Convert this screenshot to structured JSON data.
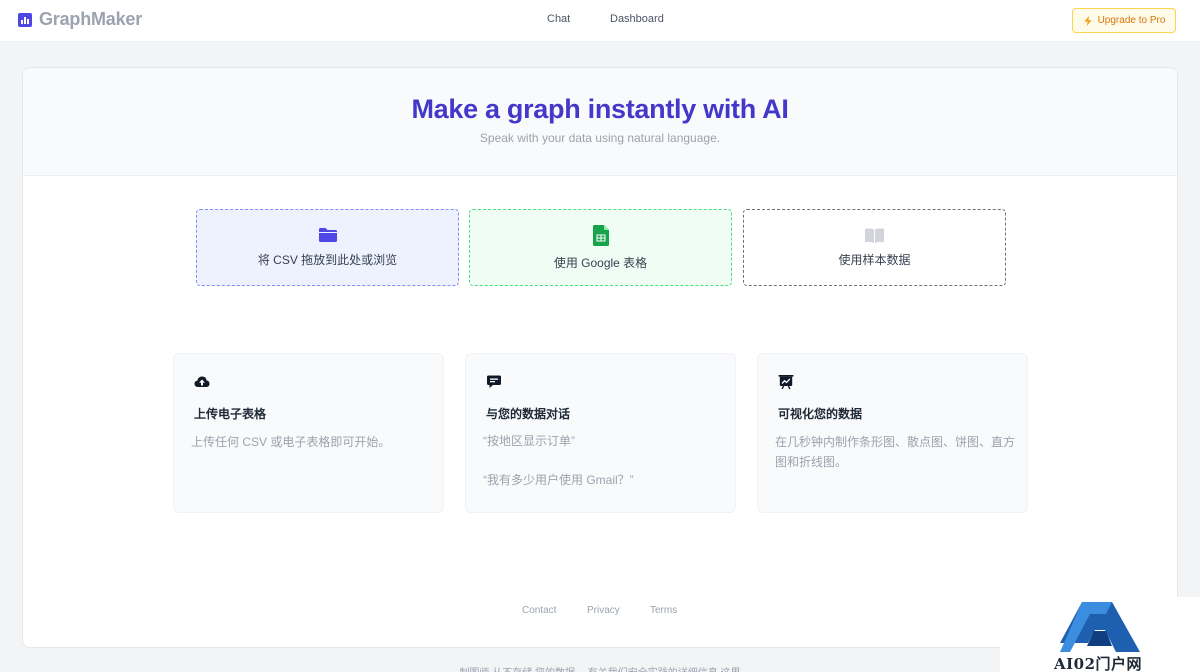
{
  "header": {
    "brand": "GraphMaker",
    "nav": [
      {
        "label": "Chat"
      },
      {
        "label": "Dashboard"
      }
    ],
    "upgrade_label": "Upgrade to Pro"
  },
  "hero": {
    "title": "Make a graph instantly with AI",
    "subtitle": "Speak with your data using natural language."
  },
  "sources": [
    {
      "label": "将 CSV 拖放到此处或浏览",
      "icon": "folder-icon",
      "color": "#4f46e5"
    },
    {
      "label": "使用 Google 表格",
      "icon": "google-sheets-icon",
      "color": "#16a34a"
    },
    {
      "label": "使用样本数据",
      "icon": "book-icon",
      "color": "#d1d5db"
    }
  ],
  "features": [
    {
      "icon": "cloud-upload-icon",
      "title": "上传电子表格",
      "desc": "上传任何 CSV 或电子表格即可开始。"
    },
    {
      "icon": "chat-bubble-icon",
      "title": "与您的数据对话",
      "quotes": [
        "“按地区显示订单”",
        "“我有多少用户使用 Gmail？”"
      ]
    },
    {
      "icon": "presentation-chart-icon",
      "title": "可视化您的数据",
      "desc": "在几秒钟内制作条形图、散点图、饼图、直方图和折线图。"
    }
  ],
  "footer": {
    "links": [
      {
        "label": "Contact"
      },
      {
        "label": "Privacy"
      },
      {
        "label": "Terms"
      }
    ],
    "note": "制图师 从不存储 您的数据。 有关我们安全实践的详细信息 这里"
  },
  "watermark": {
    "text": "AI02门户网"
  }
}
